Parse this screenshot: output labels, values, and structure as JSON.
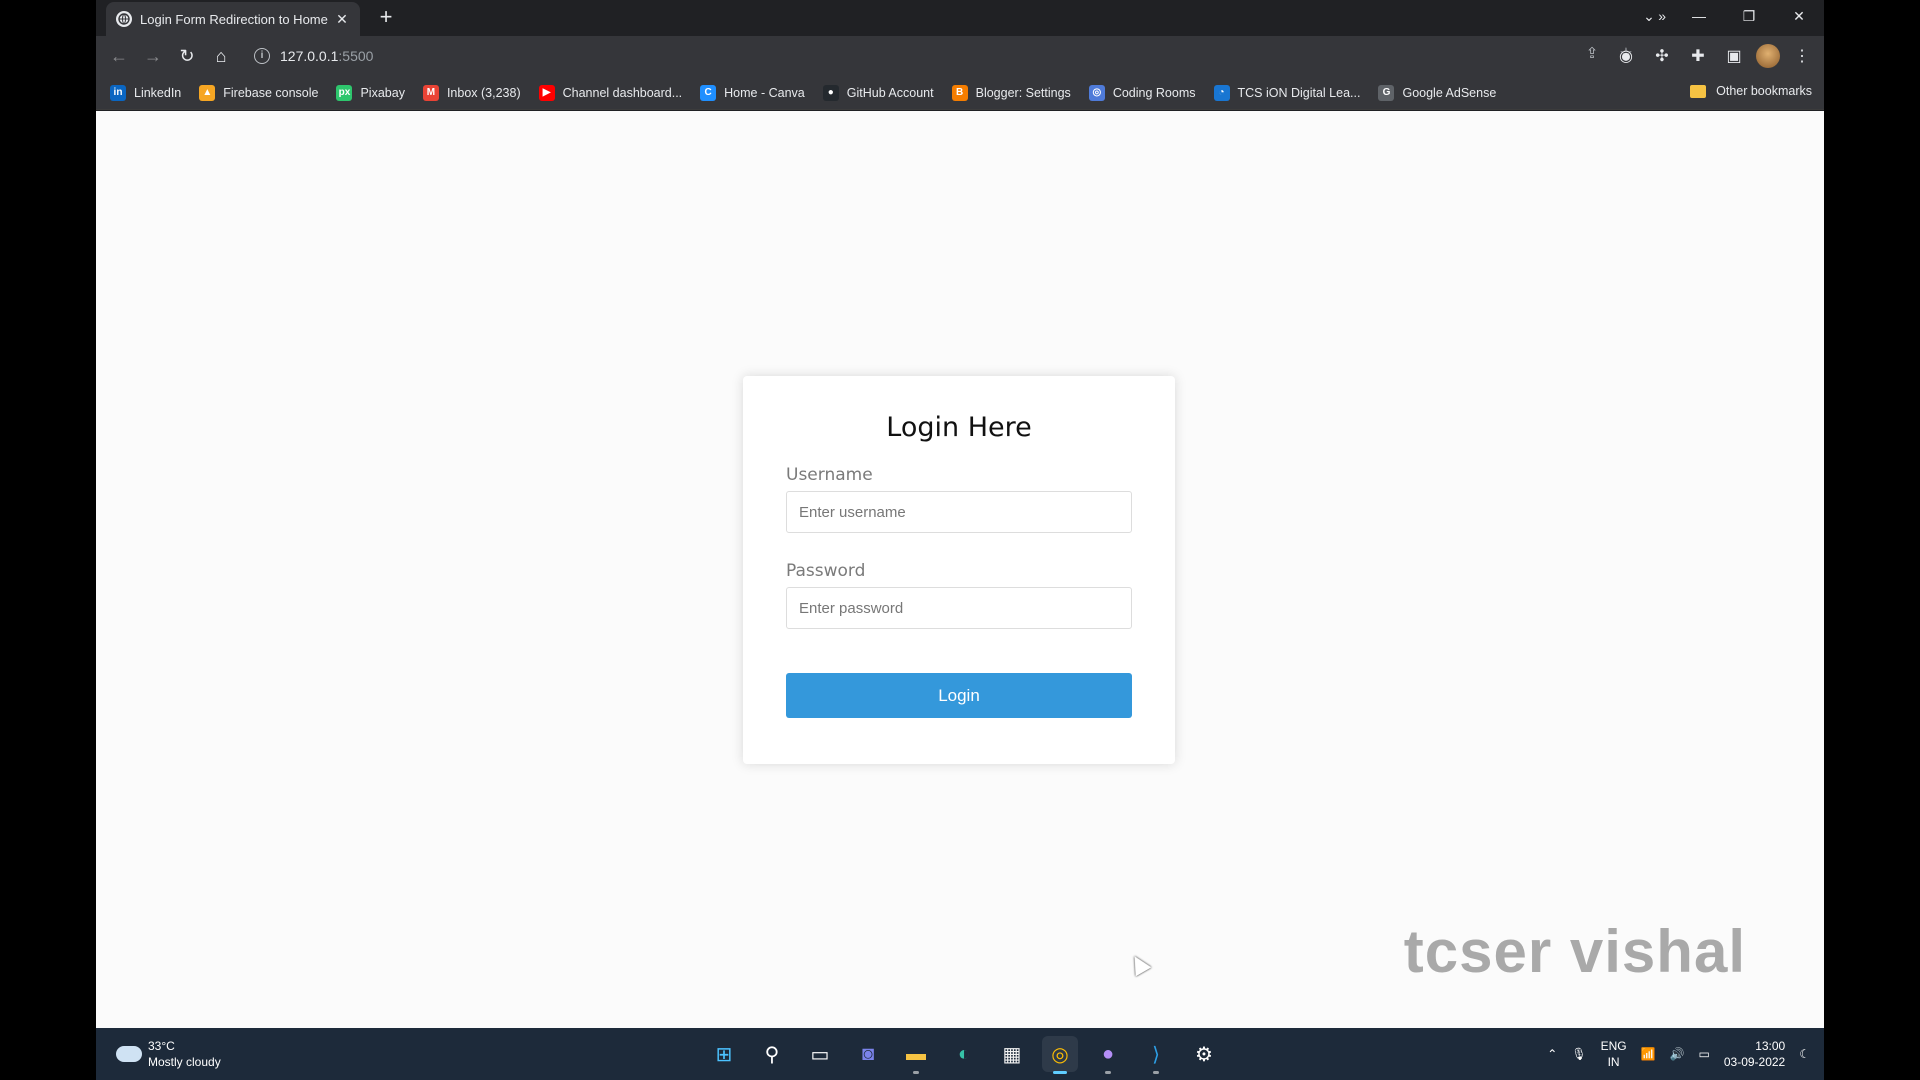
{
  "browser": {
    "tab_title": "Login Form Redirection to Home",
    "tab_close": "✕",
    "new_tab": "+",
    "url_host": "127.0.0.1",
    "url_port": ":5500"
  },
  "bookmarks": [
    {
      "label": "LinkedIn",
      "icon": "linkedin-icon",
      "color": "#0a66c2",
      "glyph": "in"
    },
    {
      "label": "Firebase console",
      "icon": "firebase-icon",
      "color": "#f6a623",
      "glyph": "▲"
    },
    {
      "label": "Pixabay",
      "icon": "pixabay-icon",
      "color": "#2ec66d",
      "glyph": "px"
    },
    {
      "label": "Inbox (3,238)",
      "icon": "gmail-icon",
      "color": "#ea4335",
      "glyph": "M"
    },
    {
      "label": "Channel dashboard...",
      "icon": "youtube-icon",
      "color": "#ff0000",
      "glyph": "▶"
    },
    {
      "label": "Home - Canva",
      "icon": "canva-icon",
      "color": "#1f8fff",
      "glyph": "C"
    },
    {
      "label": "GitHub Account",
      "icon": "github-icon",
      "color": "#24292e",
      "glyph": "●"
    },
    {
      "label": "Blogger: Settings",
      "icon": "blogger-icon",
      "color": "#f57d00",
      "glyph": "B"
    },
    {
      "label": "Coding Rooms",
      "icon": "codingrooms-icon",
      "color": "#4f7bd9",
      "glyph": "◎"
    },
    {
      "label": "TCS iON Digital Lea...",
      "icon": "tcs-ion-icon",
      "color": "#1976d2",
      "glyph": "◔"
    },
    {
      "label": "Google AdSense",
      "icon": "adsense-icon",
      "color": "#5f6368",
      "glyph": "G"
    }
  ],
  "bookmarks_more": "»",
  "other_bookmarks": "Other bookmarks",
  "page": {
    "heading": "Login Here",
    "username_label": "Username",
    "username_placeholder": "Enter username",
    "password_label": "Password",
    "password_placeholder": "Enter password",
    "login_button": "Login",
    "watermark": "tcser vishal"
  },
  "taskbar": {
    "temperature": "33°C",
    "weather": "Mostly cloudy",
    "lang_line1": "ENG",
    "lang_line2": "IN",
    "time": "13:00",
    "date": "03-09-2022"
  }
}
